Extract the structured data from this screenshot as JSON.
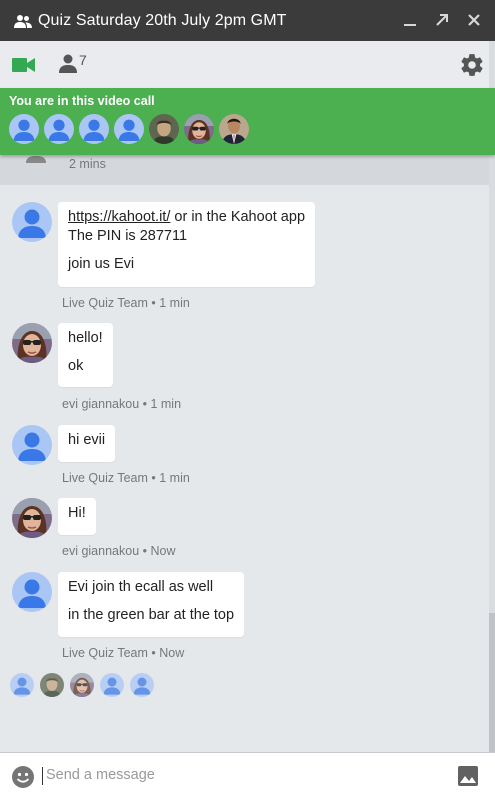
{
  "window": {
    "title": "Quiz Saturday 20th July 2pm GMT",
    "controls": [
      "minimize-icon",
      "popout-icon",
      "close-icon"
    ]
  },
  "tabs": {
    "video_tab_icon": "videocam-icon",
    "people_tab_icon": "person-icon",
    "people_count": "7",
    "settings_icon": "gear-icon"
  },
  "video_call": {
    "label": "You are in this video call",
    "participants": [
      "default",
      "default",
      "default",
      "default",
      "photo-man",
      "photo-woman-sunglasses",
      "photo-man-suit"
    ]
  },
  "previous": {
    "time": "2 mins"
  },
  "messages": [
    {
      "sender": "Live Quiz Team",
      "time": "1 min",
      "avatar": "default",
      "lines": [
        "https://kahoot.it/",
        " or in the Kahoot app",
        "The PIN is 287711",
        "join us Evi"
      ],
      "meta": "Live Quiz Team • 1 min"
    },
    {
      "sender": "evi giannakou",
      "time": "1 min",
      "avatar": "photo-woman-sunglasses",
      "lines": [
        "hello!",
        "ok"
      ],
      "meta": "evi giannakou • 1 min"
    },
    {
      "sender": "Live Quiz Team",
      "time": "1 min",
      "avatar": "default",
      "lines": [
        "hi evii"
      ],
      "meta": "Live Quiz Team • 1 min"
    },
    {
      "sender": "evi giannakou",
      "time": "Now",
      "avatar": "photo-woman-sunglasses",
      "lines": [
        "Hi!"
      ],
      "meta": "evi giannakou • Now"
    },
    {
      "sender": "Live Quiz Team",
      "time": "Now",
      "avatar": "default",
      "lines": [
        "Evi join th ecall as well",
        "in the green bar at the top"
      ],
      "meta": "Live Quiz Team • Now"
    }
  ],
  "read_receipts": [
    "default",
    "photo-man",
    "photo-woman-sunglasses",
    "default",
    "default"
  ],
  "composer": {
    "placeholder": "Send a message",
    "value": "",
    "emoji_icon": "smiley-icon",
    "image_icon": "image-icon"
  },
  "colors": {
    "titlebar": "#3b3b3b",
    "green": "#4caf50",
    "default_avatar_bg": "#a9c6f5",
    "default_avatar_fg": "#3b78e7"
  }
}
